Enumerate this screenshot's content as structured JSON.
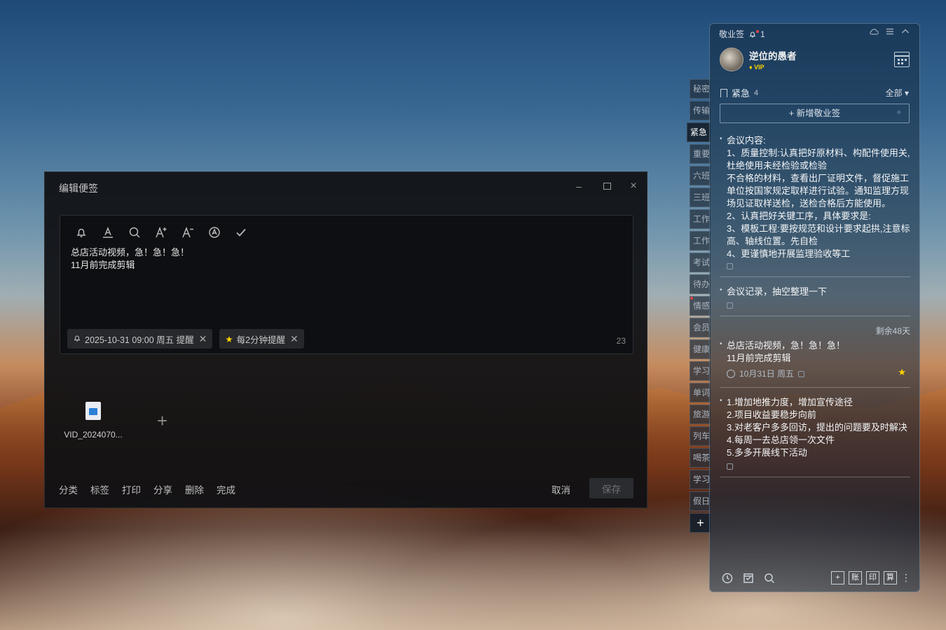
{
  "editor": {
    "title": "编辑便签",
    "window_min": "–",
    "window_close": "×",
    "content_line1": "总店活动视频，急！急！急！",
    "content_line2": "11月前完成剪辑",
    "reminder_chip": "2025-10-31 09:00 周五 提醒",
    "repeat_chip": "每2分钟提醒",
    "char_count": "23",
    "attachment_name": "VID_2024070...",
    "add_symbol": "+",
    "bottom_menu": [
      "分类",
      "标签",
      "打印",
      "分享",
      "删除",
      "完成"
    ],
    "cancel_label": "取消",
    "save_label": "保存"
  },
  "tabs": [
    "秘密",
    "传输",
    "紧急",
    "重要",
    "六班",
    "三班",
    "工作",
    "工作",
    "考试",
    "待办",
    "情感",
    "会员",
    "健康",
    "学习",
    "单词",
    "旅游",
    "列车",
    "喝茶",
    "学习",
    "假日"
  ],
  "tab_add": "+",
  "panel": {
    "app_name": "敬业签",
    "bell_count": "1",
    "user_name": "逆位的愚者",
    "vip_label": "VIP",
    "category": "紧急",
    "category_count": "4",
    "filter_label": "全部 ▾",
    "new_label": "+ 新增敬业签",
    "note1_lines": [
      "会议内容:",
      "1、质量控制:认真把好原材料、构配件使用关,杜绝使用未经检验或检验",
      "不合格的材料，查看出厂证明文件，督促施工单位按国家规定取样进行试验。通知监理方现场见证取样送检，送检合格后方能使用。",
      "2、认真把好关键工序，具体要求是:",
      "3、模板工程:要按规范和设计要求起拱,注意标高、轴线位置。先自检",
      "4、更谨慎地开展监理验收等工"
    ],
    "note2": "会议记录，抽空整理一下",
    "note3_remain": "剩余48天",
    "note3_line1": "总店活动视频，急！急！急！",
    "note3_line2": "11月前完成剪辑",
    "note3_date": "10月31日 周五",
    "note4_lines": [
      "1.增加地推力度，增加宣传途径",
      "2.项目收益要稳步向前",
      "3.对老客户多多回访，提出的问题要及时解决",
      "4.每周一去总店领一次文件",
      "5.多多开展线下活动"
    ],
    "foot_boxes": [
      "+",
      "账",
      "印",
      "算"
    ],
    "foot_more": "⋮"
  },
  "colors": {
    "editor_bg": "#101114",
    "vip": "#ffd400",
    "star": "#ffd400",
    "reddot": "#ff4545"
  }
}
